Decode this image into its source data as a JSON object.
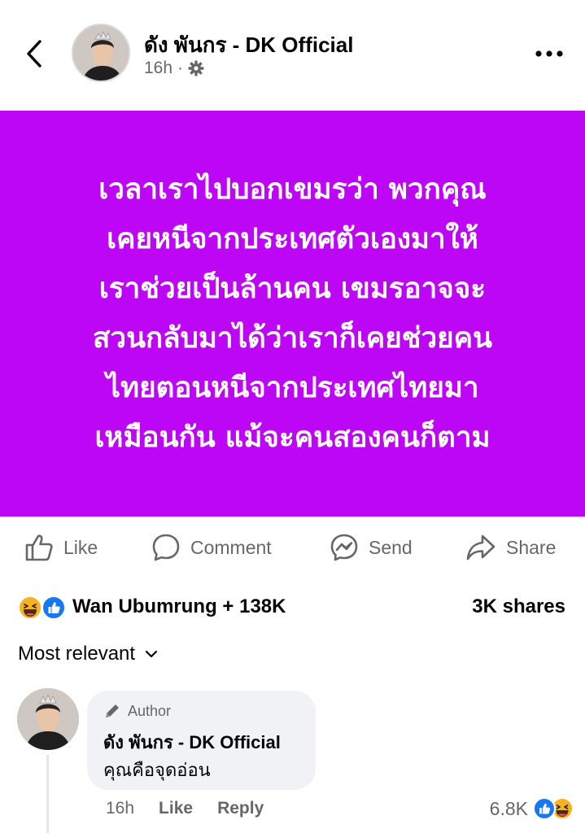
{
  "header": {
    "author_name": "ดัง พันกร - DK Official",
    "time": "16h",
    "separator": "·"
  },
  "post": {
    "background_color": "#bd06f5",
    "lines": [
      "เวลาเราไปบอกเขมรว่า พวกคุณ",
      "เคยหนีจากประเทศตัวเองมาให้",
      "เราช่วยเป็นล้านคน เขมรอาจจะ",
      "สวนกลับมาได้ว่าเราก็เคยช่วยคน",
      "ไทยตอนหนีจากประเทศไทยมา",
      "เหมือนกัน แม้จะคนสองคนก็ตาม"
    ]
  },
  "actions": {
    "like": "Like",
    "comment": "Comment",
    "send": "Send",
    "share": "Share"
  },
  "reactions": {
    "reactors": "Wan Ubumrung + 138K",
    "shares": "3K shares",
    "icons": [
      "haha-emoji-icon",
      "like-emoji-icon"
    ]
  },
  "comments_section": {
    "sort_label": "Most relevant"
  },
  "comment": {
    "badge": "Author",
    "author": "ดัง พันกร - DK Official",
    "text": "คุณคือจุดอ่อน",
    "time": "16h",
    "like": "Like",
    "reply": "Reply",
    "reaction_count": "6.8K",
    "icons": [
      "like-emoji-icon",
      "haha-emoji-icon"
    ]
  },
  "colors": {
    "like_blue": "#1877f2",
    "haha_yellow": "#f7b125",
    "secondary_text": "#65676b"
  }
}
